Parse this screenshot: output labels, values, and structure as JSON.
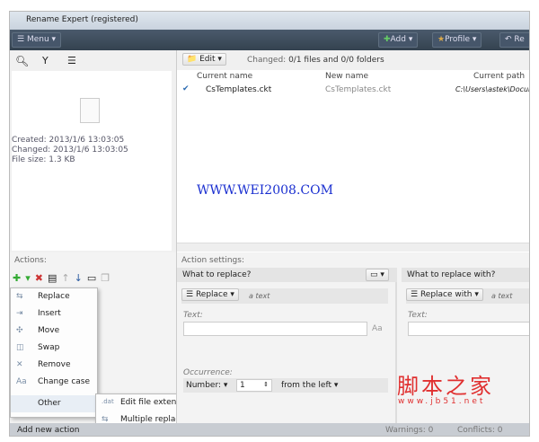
{
  "title": "Rename Expert (registered)",
  "toolbar": {
    "menu": "Menu",
    "add": "Add",
    "profile": "Profile",
    "redo": "Re"
  },
  "left": {
    "created_label": "Created:",
    "created": "2013/1/6 13:03:05",
    "changed_label": "Changed:",
    "changed": "2013/1/6 13:03:05",
    "size_label": "File size:",
    "size": "1.3 KB"
  },
  "files": {
    "edit": "Edit",
    "changed_label": "Changed:",
    "changed": "0/1 files and 0/0 folders",
    "columns": [
      "Current name",
      "New name",
      "Current path"
    ],
    "rows": [
      {
        "current": "CsTemplates.ckt",
        "new": "CsTemplates.ckt",
        "path": "C:\\Users\\astek\\Docum"
      }
    ],
    "watermark": "WWW.WEI2008.COM"
  },
  "actions": {
    "label": "Actions:",
    "status": "Add new action",
    "menu": [
      "Replace",
      "Insert",
      "Move",
      "Swap",
      "Remove",
      "Change case",
      "Other"
    ],
    "submenu": [
      {
        "icon": ".dat",
        "label": "Edit file extension"
      },
      {
        "label": "Multiple replace"
      }
    ]
  },
  "settings": {
    "label": "Action settings:",
    "what": "What to replace?",
    "with": "What to replace with?",
    "replace": "Replace",
    "replace_with": "Replace with",
    "a_text": "a text",
    "text_label": "Text:",
    "aa": "Aa",
    "occurrence": "Occurrence:",
    "number": "Number:",
    "number_value": "1",
    "from": "from the left"
  },
  "status": {
    "warnings": "Warnings: 0",
    "conflicts": "Conflicts: 0"
  },
  "logo": {
    "cn": "脚本之家",
    "url": "www.jb51.net"
  }
}
